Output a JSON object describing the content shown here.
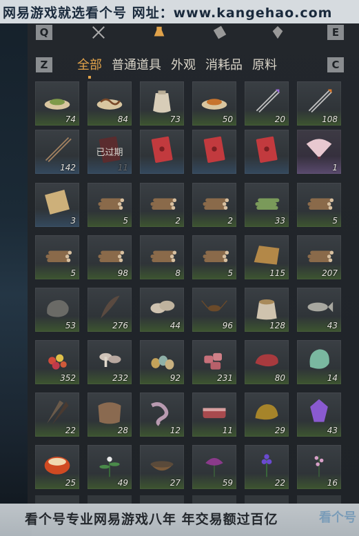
{
  "watermark_top": "网易游戏就选看个号  网址：www.kangehao.com",
  "watermark_bottom": "看个号专业网易游戏八年 年交易额过百亿",
  "corner_logo": "看个号",
  "keys": {
    "q": "Q",
    "e": "E",
    "z": "Z",
    "c": "C"
  },
  "category_icons": [
    "crossed-swords-icon",
    "potion-icon",
    "scroll-icon",
    "gem-icon"
  ],
  "tabs": [
    {
      "label": "全部",
      "active": true
    },
    {
      "label": "普通道具"
    },
    {
      "label": "外观"
    },
    {
      "label": "消耗品"
    },
    {
      "label": "原料"
    }
  ],
  "items": [
    {
      "name": "green-powder",
      "qty": "74"
    },
    {
      "name": "worm",
      "qty": "84"
    },
    {
      "name": "cloth-sack",
      "qty": "73"
    },
    {
      "name": "orange-powder",
      "qty": "50"
    },
    {
      "name": "purple-arrows",
      "qty": "20"
    },
    {
      "name": "fire-arrows",
      "qty": "108"
    },
    {
      "name": "spear-arrows",
      "qty": "142"
    },
    {
      "name": "expired-red-envelope",
      "qty": "11",
      "overlay": "已过期"
    },
    {
      "name": "red-envelope",
      "qty": ""
    },
    {
      "name": "red-envelope",
      "qty": ""
    },
    {
      "name": "red-envelope",
      "qty": ""
    },
    {
      "name": "folding-fan",
      "qty": "1"
    },
    {
      "name": "scroll-map",
      "qty": "3"
    },
    {
      "name": "logs",
      "qty": "5"
    },
    {
      "name": "logs",
      "qty": "2"
    },
    {
      "name": "logs",
      "qty": "2"
    },
    {
      "name": "bamboo-logs",
      "qty": "33"
    },
    {
      "name": "logs",
      "qty": "5"
    },
    {
      "name": "logs",
      "qty": "5"
    },
    {
      "name": "logs",
      "qty": "98"
    },
    {
      "name": "logs",
      "qty": "8"
    },
    {
      "name": "logs",
      "qty": "5"
    },
    {
      "name": "straw-bundle",
      "qty": "115"
    },
    {
      "name": "logs",
      "qty": "207"
    },
    {
      "name": "stone",
      "qty": "53"
    },
    {
      "name": "feather",
      "qty": "276"
    },
    {
      "name": "oysters",
      "qty": "44"
    },
    {
      "name": "cricket",
      "qty": "96"
    },
    {
      "name": "grain-sack",
      "qty": "128"
    },
    {
      "name": "fish",
      "qty": "43"
    },
    {
      "name": "berries",
      "qty": "352"
    },
    {
      "name": "mushrooms",
      "qty": "232"
    },
    {
      "name": "eggs",
      "qty": "92"
    },
    {
      "name": "raw-meat",
      "qty": "231"
    },
    {
      "name": "steak",
      "qty": "80"
    },
    {
      "name": "jade-stone",
      "qty": "14"
    },
    {
      "name": "bird-feathers",
      "qty": "22"
    },
    {
      "name": "animal-hide",
      "qty": "28"
    },
    {
      "name": "intestines",
      "qty": "12"
    },
    {
      "name": "meat-slab",
      "qty": "11"
    },
    {
      "name": "gold-ore",
      "qty": "29"
    },
    {
      "name": "amethyst",
      "qty": "43"
    },
    {
      "name": "amber-stone",
      "qty": "25"
    },
    {
      "name": "herb-white-flower",
      "qty": "49"
    },
    {
      "name": "herb-bowl",
      "qty": "27"
    },
    {
      "name": "purple-flower",
      "qty": "59"
    },
    {
      "name": "lavender-herb",
      "qty": "22"
    },
    {
      "name": "pink-herb",
      "qty": "16"
    }
  ]
}
